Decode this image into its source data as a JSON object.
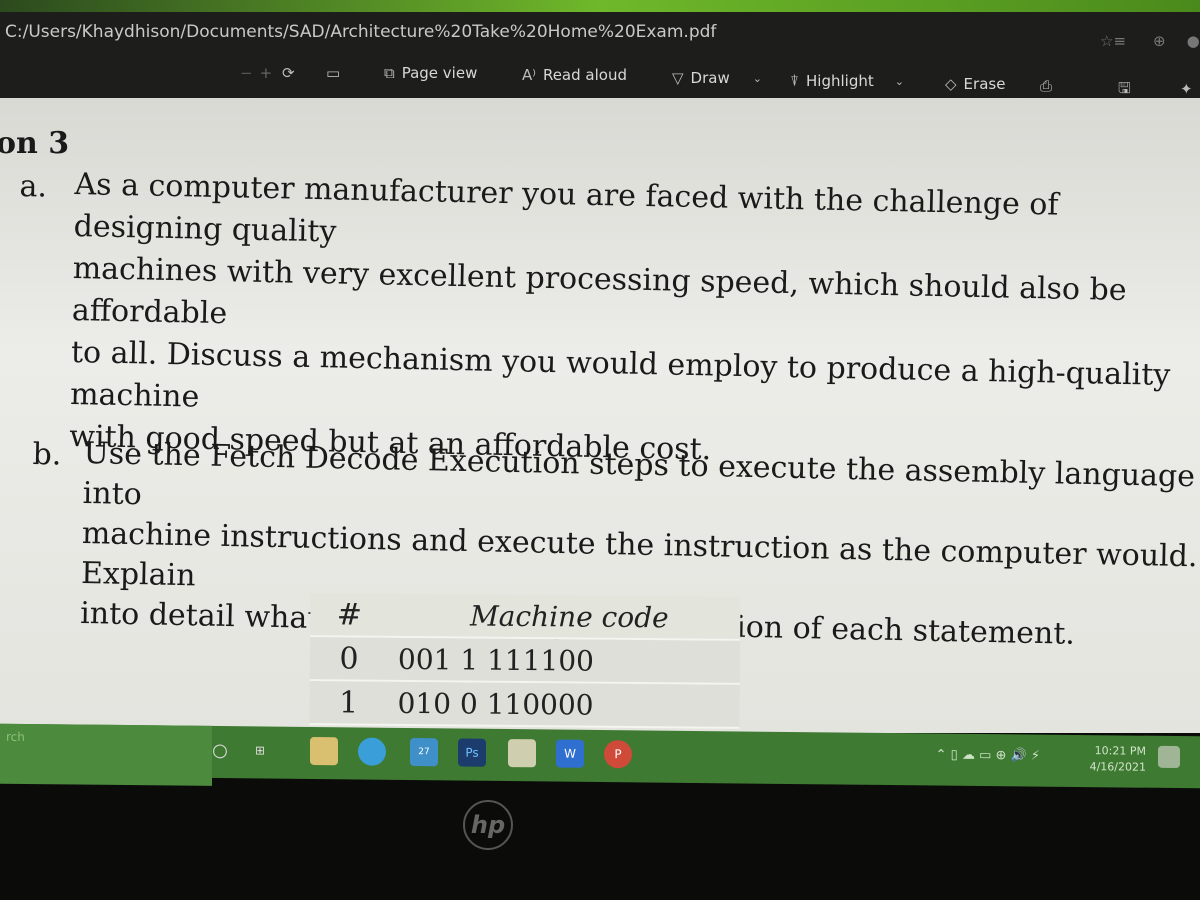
{
  "browser": {
    "address": "C:/Users/Khaydhison/Documents/SAD/Architecture%20Take%20Home%20Exam.pdf",
    "toolbar": {
      "zoom_out": "−",
      "zoom_in": "+",
      "page_view": "Page view",
      "read_aloud": "Read aloud",
      "draw": "Draw",
      "highlight": "Highlight",
      "erase": "Erase"
    }
  },
  "document": {
    "heading": "on 3",
    "question_a": {
      "marker": "a.",
      "lines": [
        "As a computer manufacturer you are faced with the challenge of designing quality",
        "machines with very excellent processing speed, which should also be affordable",
        "to all. Discuss a mechanism you would employ to produce a high-quality machine",
        "with good speed but at an affordable cost."
      ]
    },
    "question_b": {
      "marker": "b.",
      "lines": [
        "Use the Fetch Decode Execution steps to execute the assembly language into",
        "machine instructions and execute the instruction as the computer would. Explain",
        "into detail what happens during the execution of each statement."
      ]
    },
    "table": {
      "headers": [
        "#",
        "Machine code"
      ],
      "rows": [
        [
          "0",
          "001 1 111100"
        ],
        [
          "1",
          "010 0 110000"
        ]
      ]
    }
  },
  "taskbar": {
    "search": "rch",
    "apps": [
      "File Explorer",
      "Edge",
      "Mail",
      "Photoshop",
      "Store",
      "Word",
      "PowerPoint"
    ],
    "ps_label": "Ps",
    "word_label": "W",
    "ppt_label": "P",
    "mail_badge": "27",
    "time": "10:21 PM",
    "date": "4/16/2021"
  },
  "bezel": {
    "logo": "hp"
  }
}
